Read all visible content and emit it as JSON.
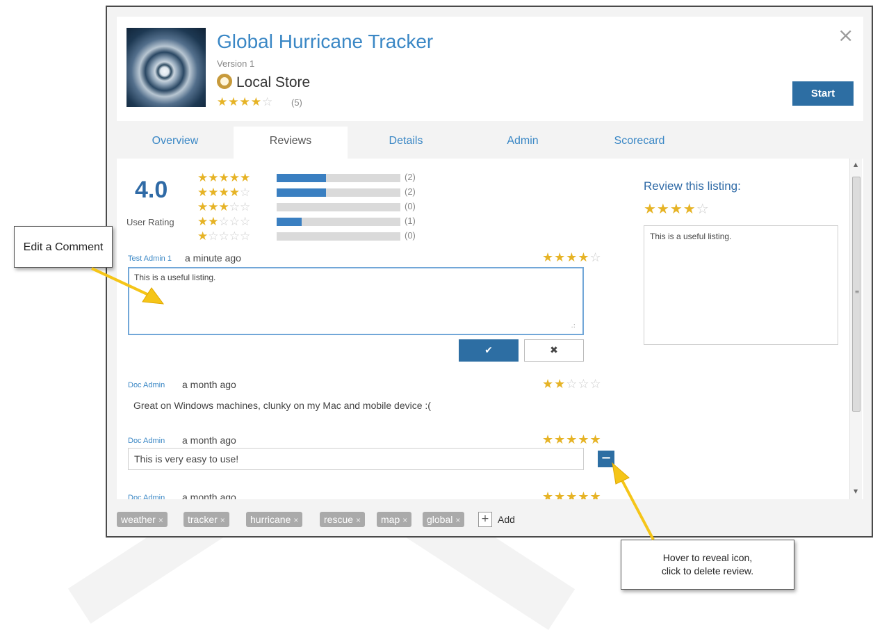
{
  "app": {
    "title": "Global Hurricane Tracker",
    "version": "Version 1",
    "store": "Local Store",
    "rating_stars": 4,
    "rating_count": "(5)",
    "close_glyph": "×",
    "start_label": "Start"
  },
  "tabs": [
    {
      "label": "Overview",
      "active": false
    },
    {
      "label": "Reviews",
      "active": true
    },
    {
      "label": "Details",
      "active": false
    },
    {
      "label": "Admin",
      "active": false
    },
    {
      "label": "Scorecard",
      "active": false
    }
  ],
  "summary": {
    "average": "4.0",
    "label": "User Rating",
    "breakdown": [
      {
        "stars": 5,
        "count": "(2)",
        "fraction": 0.4
      },
      {
        "stars": 4,
        "count": "(2)",
        "fraction": 0.4
      },
      {
        "stars": 3,
        "count": "(0)",
        "fraction": 0
      },
      {
        "stars": 2,
        "count": "(1)",
        "fraction": 0.2
      },
      {
        "stars": 1,
        "count": "(0)",
        "fraction": 0
      }
    ]
  },
  "reviews": [
    {
      "author": "Test Admin 1",
      "time": "a minute ago",
      "stars": 4,
      "text": "This is a useful listing.",
      "mode": "editing"
    },
    {
      "author": "Doc Admin",
      "time": "a month ago",
      "stars": 2,
      "text": "Great on Windows machines, clunky on my Mac and mobile device :(",
      "mode": "view"
    },
    {
      "author": "Doc Admin",
      "time": "a month ago",
      "stars": 5,
      "text": "This is very easy to use!",
      "mode": "hover"
    },
    {
      "author": "Doc Admin",
      "time": "a month ago",
      "stars": 5,
      "text": "",
      "mode": "view"
    }
  ],
  "edit_actions": {
    "confirm_glyph": "✔",
    "cancel_glyph": "✖"
  },
  "delete_glyph": "−",
  "review_form": {
    "heading": "Review this listing:",
    "stars": 4,
    "text": "This is a useful listing."
  },
  "tags": [
    {
      "label": "weather"
    },
    {
      "label": "tracker"
    },
    {
      "label": "hurricane"
    },
    {
      "label": "rescue"
    },
    {
      "label": "map"
    },
    {
      "label": "global"
    }
  ],
  "tag_remove_glyph": "×",
  "tag_add": {
    "glyph": "+",
    "label": "Add"
  },
  "callouts": {
    "edit": "Edit a Comment",
    "hover_line1": "Hover to reveal icon,",
    "hover_line2": "click to delete review."
  },
  "colors": {
    "accent": "#3a87c5",
    "button": "#2d6ea3",
    "star": "#e6b325",
    "callout_arrow": "#f5c518"
  },
  "icons": {
    "store": "local-store-icon",
    "close": "close-icon",
    "scroll_up": "scroll-up-icon",
    "scroll_down": "scroll-down-icon"
  }
}
